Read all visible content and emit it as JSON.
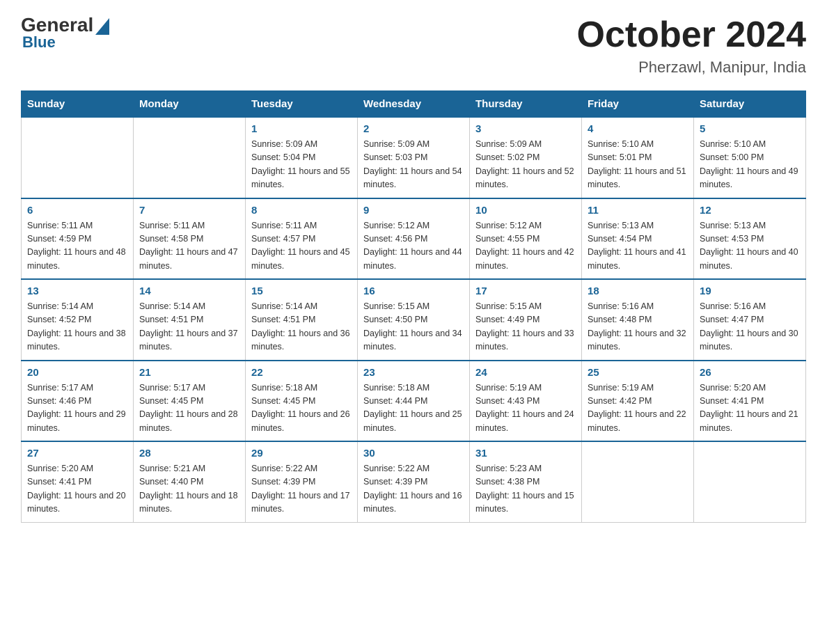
{
  "header": {
    "logo": {
      "general": "General",
      "blue": "Blue",
      "triangle": true
    },
    "title": "October 2024",
    "subtitle": "Pherzawl, Manipur, India"
  },
  "weekdays": [
    "Sunday",
    "Monday",
    "Tuesday",
    "Wednesday",
    "Thursday",
    "Friday",
    "Saturday"
  ],
  "weeks": [
    [
      {
        "day": "",
        "sunrise": "",
        "sunset": "",
        "daylight": ""
      },
      {
        "day": "",
        "sunrise": "",
        "sunset": "",
        "daylight": ""
      },
      {
        "day": "1",
        "sunrise": "Sunrise: 5:09 AM",
        "sunset": "Sunset: 5:04 PM",
        "daylight": "Daylight: 11 hours and 55 minutes."
      },
      {
        "day": "2",
        "sunrise": "Sunrise: 5:09 AM",
        "sunset": "Sunset: 5:03 PM",
        "daylight": "Daylight: 11 hours and 54 minutes."
      },
      {
        "day": "3",
        "sunrise": "Sunrise: 5:09 AM",
        "sunset": "Sunset: 5:02 PM",
        "daylight": "Daylight: 11 hours and 52 minutes."
      },
      {
        "day": "4",
        "sunrise": "Sunrise: 5:10 AM",
        "sunset": "Sunset: 5:01 PM",
        "daylight": "Daylight: 11 hours and 51 minutes."
      },
      {
        "day": "5",
        "sunrise": "Sunrise: 5:10 AM",
        "sunset": "Sunset: 5:00 PM",
        "daylight": "Daylight: 11 hours and 49 minutes."
      }
    ],
    [
      {
        "day": "6",
        "sunrise": "Sunrise: 5:11 AM",
        "sunset": "Sunset: 4:59 PM",
        "daylight": "Daylight: 11 hours and 48 minutes."
      },
      {
        "day": "7",
        "sunrise": "Sunrise: 5:11 AM",
        "sunset": "Sunset: 4:58 PM",
        "daylight": "Daylight: 11 hours and 47 minutes."
      },
      {
        "day": "8",
        "sunrise": "Sunrise: 5:11 AM",
        "sunset": "Sunset: 4:57 PM",
        "daylight": "Daylight: 11 hours and 45 minutes."
      },
      {
        "day": "9",
        "sunrise": "Sunrise: 5:12 AM",
        "sunset": "Sunset: 4:56 PM",
        "daylight": "Daylight: 11 hours and 44 minutes."
      },
      {
        "day": "10",
        "sunrise": "Sunrise: 5:12 AM",
        "sunset": "Sunset: 4:55 PM",
        "daylight": "Daylight: 11 hours and 42 minutes."
      },
      {
        "day": "11",
        "sunrise": "Sunrise: 5:13 AM",
        "sunset": "Sunset: 4:54 PM",
        "daylight": "Daylight: 11 hours and 41 minutes."
      },
      {
        "day": "12",
        "sunrise": "Sunrise: 5:13 AM",
        "sunset": "Sunset: 4:53 PM",
        "daylight": "Daylight: 11 hours and 40 minutes."
      }
    ],
    [
      {
        "day": "13",
        "sunrise": "Sunrise: 5:14 AM",
        "sunset": "Sunset: 4:52 PM",
        "daylight": "Daylight: 11 hours and 38 minutes."
      },
      {
        "day": "14",
        "sunrise": "Sunrise: 5:14 AM",
        "sunset": "Sunset: 4:51 PM",
        "daylight": "Daylight: 11 hours and 37 minutes."
      },
      {
        "day": "15",
        "sunrise": "Sunrise: 5:14 AM",
        "sunset": "Sunset: 4:51 PM",
        "daylight": "Daylight: 11 hours and 36 minutes."
      },
      {
        "day": "16",
        "sunrise": "Sunrise: 5:15 AM",
        "sunset": "Sunset: 4:50 PM",
        "daylight": "Daylight: 11 hours and 34 minutes."
      },
      {
        "day": "17",
        "sunrise": "Sunrise: 5:15 AM",
        "sunset": "Sunset: 4:49 PM",
        "daylight": "Daylight: 11 hours and 33 minutes."
      },
      {
        "day": "18",
        "sunrise": "Sunrise: 5:16 AM",
        "sunset": "Sunset: 4:48 PM",
        "daylight": "Daylight: 11 hours and 32 minutes."
      },
      {
        "day": "19",
        "sunrise": "Sunrise: 5:16 AM",
        "sunset": "Sunset: 4:47 PM",
        "daylight": "Daylight: 11 hours and 30 minutes."
      }
    ],
    [
      {
        "day": "20",
        "sunrise": "Sunrise: 5:17 AM",
        "sunset": "Sunset: 4:46 PM",
        "daylight": "Daylight: 11 hours and 29 minutes."
      },
      {
        "day": "21",
        "sunrise": "Sunrise: 5:17 AM",
        "sunset": "Sunset: 4:45 PM",
        "daylight": "Daylight: 11 hours and 28 minutes."
      },
      {
        "day": "22",
        "sunrise": "Sunrise: 5:18 AM",
        "sunset": "Sunset: 4:45 PM",
        "daylight": "Daylight: 11 hours and 26 minutes."
      },
      {
        "day": "23",
        "sunrise": "Sunrise: 5:18 AM",
        "sunset": "Sunset: 4:44 PM",
        "daylight": "Daylight: 11 hours and 25 minutes."
      },
      {
        "day": "24",
        "sunrise": "Sunrise: 5:19 AM",
        "sunset": "Sunset: 4:43 PM",
        "daylight": "Daylight: 11 hours and 24 minutes."
      },
      {
        "day": "25",
        "sunrise": "Sunrise: 5:19 AM",
        "sunset": "Sunset: 4:42 PM",
        "daylight": "Daylight: 11 hours and 22 minutes."
      },
      {
        "day": "26",
        "sunrise": "Sunrise: 5:20 AM",
        "sunset": "Sunset: 4:41 PM",
        "daylight": "Daylight: 11 hours and 21 minutes."
      }
    ],
    [
      {
        "day": "27",
        "sunrise": "Sunrise: 5:20 AM",
        "sunset": "Sunset: 4:41 PM",
        "daylight": "Daylight: 11 hours and 20 minutes."
      },
      {
        "day": "28",
        "sunrise": "Sunrise: 5:21 AM",
        "sunset": "Sunset: 4:40 PM",
        "daylight": "Daylight: 11 hours and 18 minutes."
      },
      {
        "day": "29",
        "sunrise": "Sunrise: 5:22 AM",
        "sunset": "Sunset: 4:39 PM",
        "daylight": "Daylight: 11 hours and 17 minutes."
      },
      {
        "day": "30",
        "sunrise": "Sunrise: 5:22 AM",
        "sunset": "Sunset: 4:39 PM",
        "daylight": "Daylight: 11 hours and 16 minutes."
      },
      {
        "day": "31",
        "sunrise": "Sunrise: 5:23 AM",
        "sunset": "Sunset: 4:38 PM",
        "daylight": "Daylight: 11 hours and 15 minutes."
      },
      {
        "day": "",
        "sunrise": "",
        "sunset": "",
        "daylight": ""
      },
      {
        "day": "",
        "sunrise": "",
        "sunset": "",
        "daylight": ""
      }
    ]
  ]
}
